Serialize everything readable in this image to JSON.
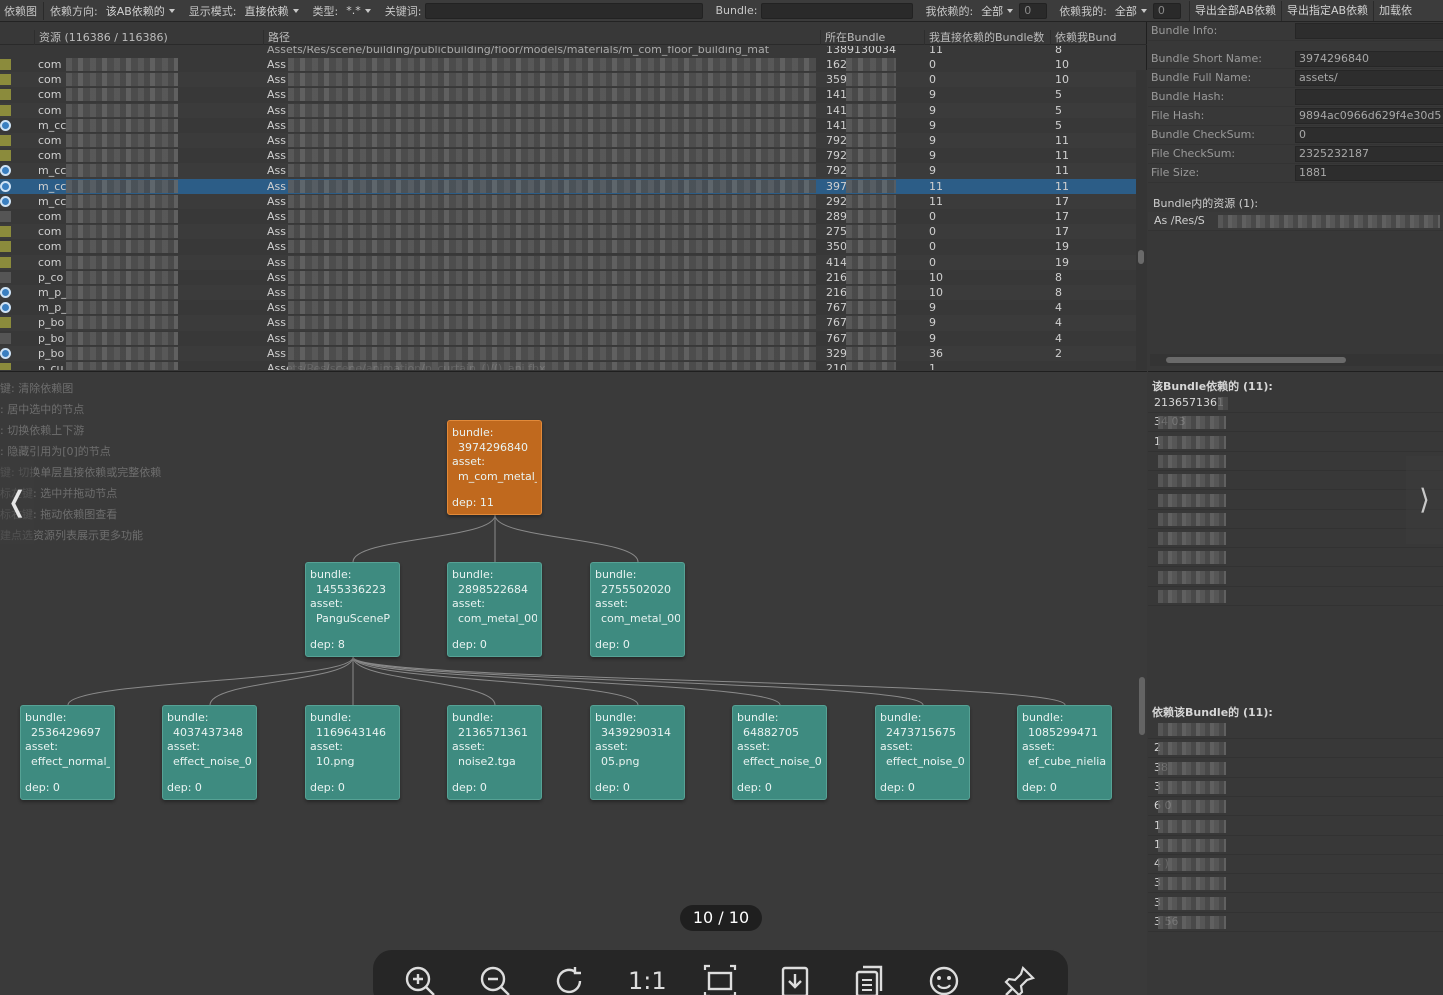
{
  "toolbar": {
    "view_tab": "依赖图",
    "direction_label": "依赖方向:",
    "direction_value": "该AB依赖的",
    "mode_label": "显示模式:",
    "mode_value": "直接依赖",
    "type_label": "类型:",
    "type_value": "*.*",
    "keyword_label": "关键词:",
    "bundle_label": "Bundle:",
    "my_deps_label": "我依赖的:",
    "my_deps_value": "全部",
    "my_deps_count": "0",
    "deps_me_label": "依赖我的:",
    "deps_me_value": "全部",
    "deps_me_count": "0",
    "export_all": "导出全部AB依赖",
    "export_selected": "导出指定AB依赖",
    "load_deps": "加载依"
  },
  "table": {
    "headers": [
      "资源 (116386 / 116386)",
      "路径",
      "所在Bundle",
      "我直接依赖的Bundle数",
      "依赖我Bund"
    ],
    "partial_row": {
      "path": "Assets/Res/scene/building/publicbuilding/floor/models/materials/m_com_floor_building_mat",
      "bundle": "1389130034",
      "c1": "11",
      "c2": "8"
    },
    "rows": [
      {
        "icon": "tex",
        "res": "com",
        "path": "Ass",
        "bundle": "162",
        "c1": "0",
        "c2": "10"
      },
      {
        "icon": "tex",
        "res": "com",
        "path": "Ass",
        "bundle": "359",
        "c1": "0",
        "c2": "10"
      },
      {
        "icon": "tex",
        "res": "com",
        "path": "Ass",
        "bundle": "141",
        "c1": "9",
        "c2": "5"
      },
      {
        "icon": "tex",
        "res": "com",
        "path": "Ass",
        "bundle": "141",
        "c1": "9",
        "c2": "5"
      },
      {
        "icon": "circ",
        "res": "m_cc",
        "path": "Ass",
        "bundle": "141",
        "c1": "9",
        "c2": "5"
      },
      {
        "icon": "tex",
        "res": "com",
        "path": "Ass",
        "bundle": "792",
        "c1": "9",
        "c2": "11"
      },
      {
        "icon": "tex",
        "res": "com",
        "path": "Ass",
        "bundle": "792",
        "c1": "9",
        "c2": "11"
      },
      {
        "icon": "circ",
        "res": "m_cc",
        "path": "Ass",
        "bundle": "792",
        "c1": "9",
        "c2": "11"
      },
      {
        "icon": "circ",
        "res": "m_cc",
        "path": "Ass",
        "bundle": "397",
        "c1": "11",
        "c2": "11",
        "selected": true
      },
      {
        "icon": "circ",
        "res": "m_cc",
        "path": "Ass",
        "bundle": "292",
        "c1": "11",
        "c2": "17"
      },
      {
        "icon": "blk",
        "res": "com",
        "path": "Ass",
        "bundle": "289",
        "c1": "0",
        "c2": "17"
      },
      {
        "icon": "tex",
        "res": "com",
        "path": "Ass",
        "bundle": "275",
        "c1": "0",
        "c2": "17"
      },
      {
        "icon": "tex",
        "res": "com",
        "path": "Ass",
        "bundle": "350",
        "c1": "0",
        "c2": "19"
      },
      {
        "icon": "tex",
        "res": "com",
        "path": "Ass",
        "bundle": "414",
        "c1": "0",
        "c2": "19"
      },
      {
        "icon": "blk",
        "res": "p_co",
        "path": "Ass",
        "bundle": "216",
        "c1": "10",
        "c2": "8"
      },
      {
        "icon": "circ",
        "res": "m_p_",
        "path": "Ass",
        "bundle": "216",
        "c1": "10",
        "c2": "8"
      },
      {
        "icon": "circ",
        "res": "m_p_",
        "path": "Ass",
        "bundle": "767",
        "c1": "9",
        "c2": "4"
      },
      {
        "icon": "tex",
        "res": "p_bo",
        "path": "Ass",
        "bundle": "767",
        "c1": "9",
        "c2": "4"
      },
      {
        "icon": "blk",
        "res": "p_bo",
        "path": "Ass",
        "bundle": "767",
        "c1": "9",
        "c2": "4"
      },
      {
        "icon": "circ",
        "res": "p_bo",
        "path": "Ass",
        "bundle": "329",
        "c1": "36",
        "c2": "2"
      },
      {
        "icon": "tex",
        "res": "p_cu",
        "path": "Assets/Res/scene/animation/p_curtain_()/()_ani.fbx",
        "bundle": "210",
        "c1": "1",
        "c2": ""
      }
    ]
  },
  "info": {
    "title": "Bundle Info:",
    "fields": [
      {
        "label": "Bundle Short Name:",
        "value": "3974296840"
      },
      {
        "label": "Bundle Full Name:",
        "value": "assets/"
      },
      {
        "label": "Bundle Hash:",
        "value": ""
      },
      {
        "label": "File Hash:",
        "value": "9894ac0966d629f4e30d5"
      },
      {
        "label": "Bundle CheckSum:",
        "value": "0"
      },
      {
        "label": "File CheckSum:",
        "value": "2325232187"
      },
      {
        "label": "File Size:",
        "value": "1881"
      }
    ],
    "assets_header": "Bundle内的资源 (1):",
    "asset_item": "As   /Res/S"
  },
  "hints": [
    "键: 清除依赖图",
    ": 居中选中的节点",
    ": 切换依赖上下游",
    ": 隐藏引用为[0]的节点",
    "键: 切换单层直接依赖或完整依赖",
    "标左键: 选中并拖动节点",
    "标右键: 拖动依赖图查看",
    "建点选资源列表展示更多功能"
  ],
  "graph": {
    "nodes": [
      {
        "bundle": "3974296840",
        "asset": "m_com_metal_(",
        "dep": "dep: 11",
        "root": true
      },
      {
        "bundle": "1455336223",
        "asset": "PanguSceneP",
        "dep": "dep: 8"
      },
      {
        "bundle": "2898522684",
        "asset": "com_metal_00",
        "dep": "dep: 0"
      },
      {
        "bundle": "2755502020",
        "asset": "com_metal_00",
        "dep": "dep: 0"
      },
      {
        "bundle": "2536429697",
        "asset": "effect_normal_",
        "dep": "dep: 0"
      },
      {
        "bundle": "4037437348",
        "asset": "effect_noise_0",
        "dep": "dep: 0"
      },
      {
        "bundle": "1169643146",
        "asset": "10.png",
        "dep": "dep: 0"
      },
      {
        "bundle": "2136571361",
        "asset": "noise2.tga",
        "dep": "dep: 0"
      },
      {
        "bundle": "3439290314",
        "asset": "05.png",
        "dep": "dep: 0"
      },
      {
        "bundle": "64882705",
        "asset": "effect_noise_0",
        "dep": "dep: 0"
      },
      {
        "bundle": "2473715675",
        "asset": "effect_noise_0",
        "dep": "dep: 0"
      },
      {
        "bundle": "1085299471",
        "asset": "ef_cube_nieliai",
        "dep": "dep: 0"
      }
    ],
    "bundle_label": "bundle:",
    "asset_label": "asset:"
  },
  "deps": {
    "depends_header": "该Bundle依赖的 (11):",
    "depends_items": [
      "2136571361",
      "34  03",
      "1",
      "",
      "",
      "",
      "",
      "",
      "",
      "",
      ""
    ],
    "dependents_header": "依赖该Bundle的 (11):",
    "dependents_items": [
      "",
      "2",
      "38",
      "3",
      "6   0",
      "1",
      "1",
      "4  )",
      "3",
      "3",
      "3  56"
    ]
  },
  "viewer": {
    "counter": "10 / 10",
    "nav_prev": "❬",
    "nav_next": "⟩",
    "ratio_label": "1:1"
  }
}
